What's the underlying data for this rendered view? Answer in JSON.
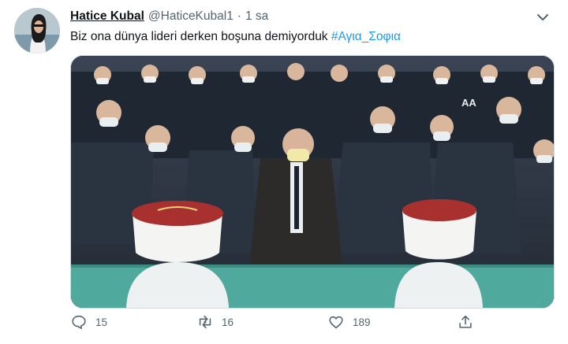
{
  "tweet": {
    "display_name": "Hatice Kubal",
    "handle": "@HaticeKubal1",
    "separator": "·",
    "time": "1 sa",
    "text": "Biz ona dünya lideri derken boşuna demiyorduk",
    "hashtag": "#Αγια_Σοφια",
    "media_watermark": "AA"
  },
  "actions": {
    "reply_count": "15",
    "retweet_count": "16",
    "like_count": "189"
  },
  "icons": {
    "reply": "reply-icon",
    "retweet": "retweet-icon",
    "like": "like-icon",
    "share": "share-icon",
    "menu": "chevron-down-icon"
  },
  "colors": {
    "hashtag": "#1d9bf0",
    "secondary_text": "#536471",
    "carpet": "#4fa99c"
  }
}
